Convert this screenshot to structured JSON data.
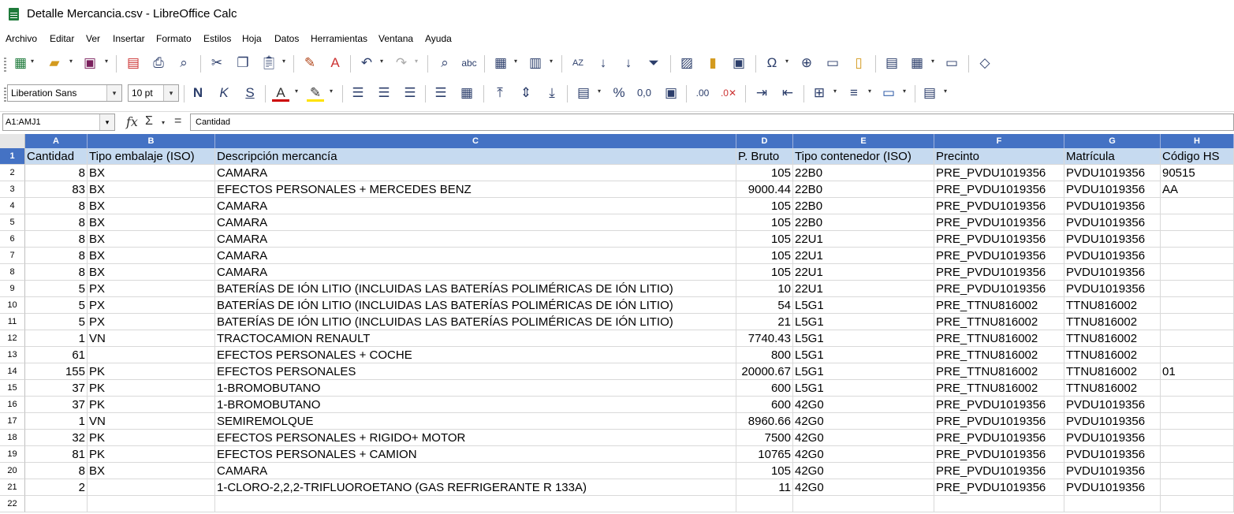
{
  "window": {
    "title": "Detalle Mercancia.csv - LibreOffice Calc"
  },
  "menu": [
    "Archivo",
    "Editar",
    "Ver",
    "Insertar",
    "Formato",
    "Estilos",
    "Hoja",
    "Datos",
    "Herramientas",
    "Ventana",
    "Ayuda"
  ],
  "format_toolbar": {
    "font_name": "Liberation Sans",
    "font_size": "10 pt"
  },
  "formula_bar": {
    "name_box": "A1:AMJ1",
    "content": "Cantidad"
  },
  "columns": [
    "A",
    "B",
    "C",
    "D",
    "E",
    "F",
    "G",
    "H"
  ],
  "headers": [
    "Cantidad",
    "Tipo embalaje (ISO)",
    "Descripción mercancía",
    "P. Bruto",
    "Tipo contenedor (ISO)",
    "Precinto",
    "Matrícula",
    "Código HS"
  ],
  "rows": [
    [
      "8",
      "BX",
      "CAMARA",
      "105",
      "22B0",
      "PRE_PVDU1019356",
      "PVDU1019356",
      "90515"
    ],
    [
      "83",
      "BX",
      "EFECTOS PERSONALES + MERCEDES BENZ",
      "9000.44",
      "22B0",
      "PRE_PVDU1019356",
      "PVDU1019356",
      "AA"
    ],
    [
      "8",
      "BX",
      "CAMARA",
      "105",
      "22B0",
      "PRE_PVDU1019356",
      "PVDU1019356",
      ""
    ],
    [
      "8",
      "BX",
      "CAMARA",
      "105",
      "22B0",
      "PRE_PVDU1019356",
      "PVDU1019356",
      ""
    ],
    [
      "8",
      "BX",
      "CAMARA",
      "105",
      "22U1",
      "PRE_PVDU1019356",
      "PVDU1019356",
      ""
    ],
    [
      "8",
      "BX",
      "CAMARA",
      "105",
      "22U1",
      "PRE_PVDU1019356",
      "PVDU1019356",
      ""
    ],
    [
      "8",
      "BX",
      "CAMARA",
      "105",
      "22U1",
      "PRE_PVDU1019356",
      "PVDU1019356",
      ""
    ],
    [
      "5",
      "PX",
      "BATERÍAS DE IÓN LITIO (INCLUIDAS LAS BATERÍAS POLIMÉRICAS DE IÓN LITIO)",
      "10",
      "22U1",
      "PRE_PVDU1019356",
      "PVDU1019356",
      ""
    ],
    [
      "5",
      "PX",
      "BATERÍAS DE IÓN LITIO (INCLUIDAS LAS BATERÍAS POLIMÉRICAS DE IÓN LITIO)",
      "54",
      "L5G1",
      "PRE_TTNU816002",
      "TTNU816002",
      ""
    ],
    [
      "5",
      "PX",
      "BATERÍAS DE IÓN LITIO (INCLUIDAS LAS BATERÍAS POLIMÉRICAS DE IÓN LITIO)",
      "21",
      "L5G1",
      "PRE_TTNU816002",
      "TTNU816002",
      ""
    ],
    [
      "1",
      "VN",
      "TRACTOCAMION RENAULT",
      "7740.43",
      "L5G1",
      "PRE_TTNU816002",
      "TTNU816002",
      ""
    ],
    [
      "61",
      "",
      "EFECTOS PERSONALES + COCHE",
      "800",
      "L5G1",
      "PRE_TTNU816002",
      "TTNU816002",
      ""
    ],
    [
      "155",
      "PK",
      "EFECTOS PERSONALES",
      "20000.67",
      "L5G1",
      "PRE_TTNU816002",
      "TTNU816002",
      "01"
    ],
    [
      "37",
      "PK",
      "1-BROMOBUTANO",
      "600",
      "L5G1",
      "PRE_TTNU816002",
      "TTNU816002",
      ""
    ],
    [
      "37",
      "PK",
      "1-BROMOBUTANO",
      "600",
      "42G0",
      "PRE_PVDU1019356",
      "PVDU1019356",
      ""
    ],
    [
      "1",
      "VN",
      "SEMIREMOLQUE",
      "8960.66",
      "42G0",
      "PRE_PVDU1019356",
      "PVDU1019356",
      ""
    ],
    [
      "32",
      "PK",
      "EFECTOS PERSONALES + RIGIDO+ MOTOR",
      "7500",
      "42G0",
      "PRE_PVDU1019356",
      "PVDU1019356",
      ""
    ],
    [
      "81",
      "PK",
      "EFECTOS PERSONALES + CAMION",
      "10765",
      "42G0",
      "PRE_PVDU1019356",
      "PVDU1019356",
      ""
    ],
    [
      "8",
      "BX",
      "CAMARA",
      "105",
      "42G0",
      "PRE_PVDU1019356",
      "PVDU1019356",
      ""
    ],
    [
      "2",
      "",
      "1-CLORO-2,2,2-TRIFLUOROETANO (GAS REFRIGERANTE R 133A)",
      "11",
      "42G0",
      "PRE_PVDU1019356",
      "PVDU1019356",
      ""
    ],
    [
      "",
      "",
      "",
      "",
      "",
      "",
      "",
      ""
    ]
  ]
}
